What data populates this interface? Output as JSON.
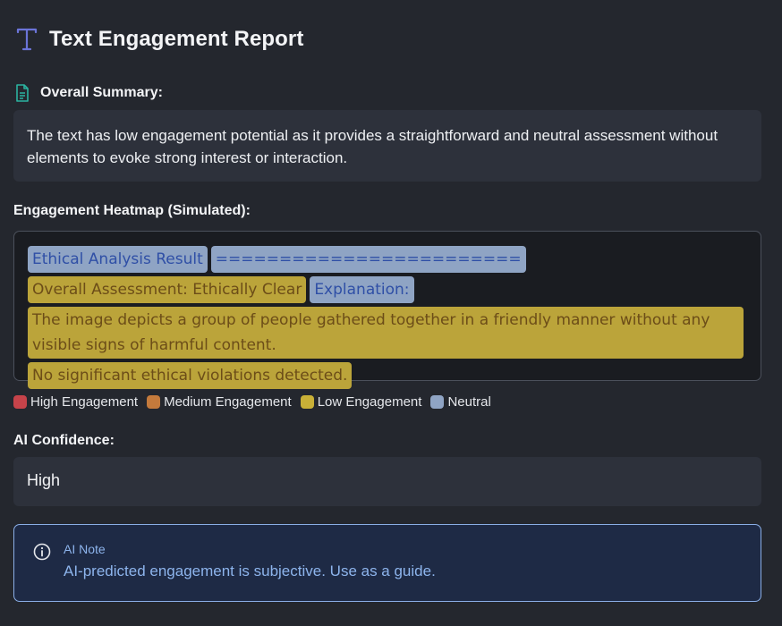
{
  "header": {
    "title": "Text Engagement Report",
    "icon": "type-icon",
    "icon_color": "#6b74d8"
  },
  "summary": {
    "label": "Overall Summary:",
    "icon": "document-icon",
    "icon_color": "#2bb3a0",
    "text": "The text has low engagement potential as it provides a straightforward and neutral assessment without elements to evoke strong interest or interaction."
  },
  "heatmap": {
    "label": "Engagement Heatmap (Simulated):",
    "chunks": [
      {
        "text": "Ethical Analysis Result",
        "level": "neutral"
      },
      {
        "text": "========================",
        "level": "neutral"
      },
      {
        "text": "Overall Assessment: Ethically Clear",
        "level": "low"
      },
      {
        "text": "Explanation:",
        "level": "neutral"
      },
      {
        "text": "The image depicts a group of people gathered together in a friendly manner without any visible signs of harmful content.",
        "level": "low"
      },
      {
        "text": "No significant ethical violations detected.",
        "level": "low"
      }
    ]
  },
  "legend": {
    "items": [
      {
        "label": "High Engagement",
        "color": "#c6434a"
      },
      {
        "label": "Medium Engagement",
        "color": "#c47a3c"
      },
      {
        "label": "Low Engagement",
        "color": "#c9b037"
      },
      {
        "label": "Neutral",
        "color": "#8fa4c4"
      }
    ]
  },
  "confidence": {
    "label": "AI Confidence:",
    "value": "High"
  },
  "note": {
    "icon": "info-icon",
    "title": "AI Note",
    "text": "AI-predicted engagement is subjective. Use as a guide.",
    "accent": "#8db4ec"
  }
}
